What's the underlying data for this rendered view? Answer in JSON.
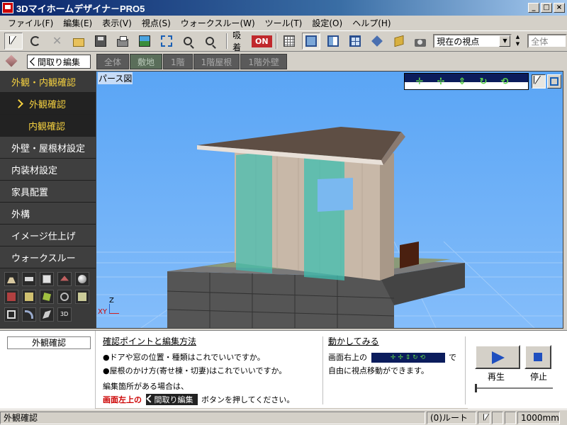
{
  "window": {
    "title": "3Dマイホームデザイナ－PRO5",
    "minimize": "_",
    "maximize": "□",
    "close": "×"
  },
  "menu": [
    "ファイル(F)",
    "編集(E)",
    "表示(V)",
    "視点(S)",
    "ウォークスルー(W)",
    "ツール(T)",
    "設定(O)",
    "ヘルプ(H)"
  ],
  "toolbar": {
    "snap_label": "吸着",
    "snap_state": "ON",
    "viewpoint_select": "現在の視点",
    "scope_field": "全体",
    "icons": [
      "cursor-icon",
      "undo-icon",
      "delete-icon",
      "open-folder-icon",
      "save-icon",
      "print-icon",
      "image-icon",
      "fit-icon",
      "zoom-in-icon",
      "zoom-out-icon",
      "grid-icon",
      "single-view-icon",
      "split-view-icon",
      "quad-view-icon",
      "layer-icon",
      "box-icon",
      "camera-icon"
    ]
  },
  "row2": {
    "back_button": "間取り編集",
    "floor_tabs": [
      "全体",
      "敷地",
      "1階",
      "1階屋根",
      "1階外壁"
    ]
  },
  "sidebar": {
    "items": [
      {
        "label": "外観・内観確認"
      },
      {
        "label": "外観確認"
      },
      {
        "label": "内観確認"
      },
      {
        "label": "外壁・屋根材設定"
      },
      {
        "label": "内装材設定"
      },
      {
        "label": "家具配置"
      },
      {
        "label": "外構"
      },
      {
        "label": "イメージ仕上げ"
      },
      {
        "label": "ウォークスルー"
      }
    ],
    "tools_row3_label": "3D"
  },
  "viewport": {
    "label": "パース図",
    "axis_z": "Z",
    "axis_xy": "XY",
    "colors": {
      "sky": "#5aa5f5",
      "roof": "#6a5a50",
      "wall": "#c8b8a8",
      "glass": "#3fbfb0",
      "floor": "#606060"
    }
  },
  "bottom": {
    "mode_field": "外観確認",
    "check_title": "確認ポイントと編集方法",
    "check_lines": [
      "●ドアや窓の位置・種類はこれでいいですか。",
      "●屋根のかけ方(寄せ棟・切妻)はこれでいいですか。"
    ],
    "edit_intro": "編集箇所がある場合は、",
    "edit_red": "画面左上の",
    "edit_tag": "間取り編集",
    "edit_tail": "ボタンを押してください。",
    "move_title": "動かしてみる",
    "move_line1_pre": "画面右上の",
    "move_line1_post": "で",
    "move_line2": "自由に視点移動ができます。",
    "play_label": "再生",
    "stop_label": "停止"
  },
  "statusbar": {
    "left": "外観確認",
    "route": "(0)ルート",
    "unit": "1000mm"
  }
}
